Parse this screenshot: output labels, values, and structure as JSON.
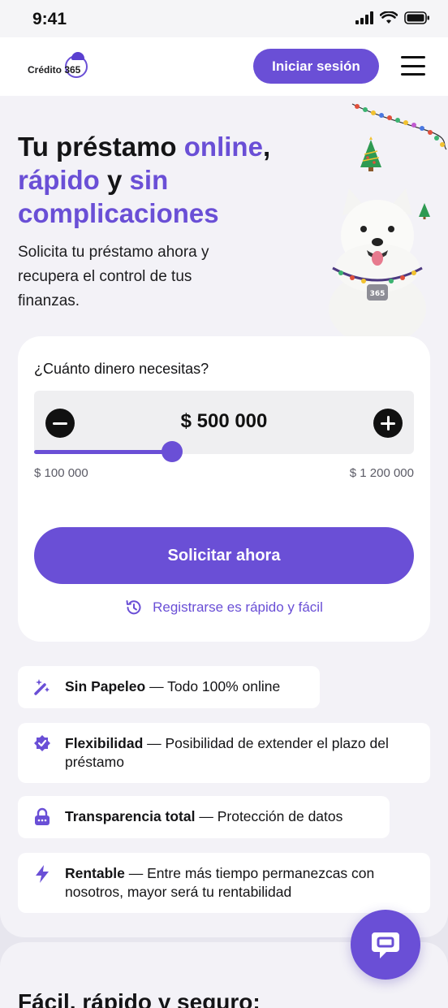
{
  "status_bar": {
    "time": "9:41"
  },
  "header": {
    "logo_text": "Crédito 365",
    "login_label": "Iniciar sesión"
  },
  "hero": {
    "title_1": "Tu préstamo ",
    "title_2": "online",
    "title_3": ",",
    "title_4": "rápido",
    "title_5": " y ",
    "title_6": "sin complicaciones",
    "subtitle": "Solicita tu préstamo ahora y recupera el control de tus finanzas.",
    "dog_tag": "365"
  },
  "loan": {
    "question": "¿Cuánto dinero necesitas?",
    "amount": "$ 500 000",
    "min_label": "$ 100 000",
    "max_label": "$ 1 200 000",
    "min_value": 100000,
    "max_value": 1200000,
    "selected_value": 500000,
    "apply_label": "Solicitar ahora",
    "register_label": "Registrarse es rápido y fácil"
  },
  "features": [
    {
      "icon": "magic-wand-icon",
      "title": "Sin Papeleo",
      "text": " — Todo 100% online"
    },
    {
      "icon": "verified-badge-icon",
      "title": "Flexibilidad",
      "text": " — Posibilidad de extender el plazo del préstamo"
    },
    {
      "icon": "lock-icon",
      "title": "Transparencia total",
      "text": " — Protección de datos"
    },
    {
      "icon": "lightning-icon",
      "title": "Rentable",
      "text": " — Entre más tiempo permanezcas con nosotros, mayor será tu rentabilidad"
    }
  ],
  "section2": {
    "title": "Fácil, rápido y seguro:"
  },
  "colors": {
    "accent": "#6a4fd6",
    "background": "#f3f2f7",
    "card": "#ffffff"
  }
}
